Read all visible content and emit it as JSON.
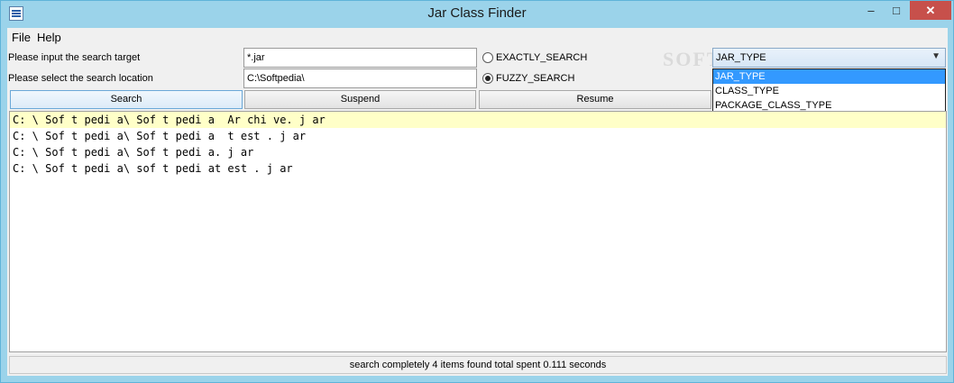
{
  "window": {
    "title": "Jar Class Finder",
    "controls": {
      "minimize": "–",
      "maximize": "□",
      "close": "✕"
    }
  },
  "menu": {
    "items": [
      "File",
      "Help"
    ]
  },
  "form": {
    "target_label": "Please input the search target",
    "target_value": "*.jar",
    "location_label": "Please select the search location",
    "location_value": "C:\\Softpedia\\",
    "radio_exact": {
      "label": "EXACTLY_SEARCH",
      "checked": false
    },
    "radio_fuzzy": {
      "label": "FUZZY_SEARCH",
      "checked": true
    },
    "combo": {
      "selected": "JAR_TYPE",
      "options": [
        "JAR_TYPE",
        "CLASS_TYPE",
        "PACKAGE_CLASS_TYPE"
      ],
      "highlighted_index": 0
    }
  },
  "buttons": {
    "search": "Search",
    "suspend": "Suspend",
    "resume": "Resume"
  },
  "results": [
    "C: \\ Sof t pedi a\\ Sof t pedi a  Ar chi ve. j ar",
    "C: \\ Sof t pedi a\\ Sof t pedi a  t est . j ar",
    "C: \\ Sof t pedi a\\ Sof t pedi a. j ar",
    "C: \\ Sof t pedi a\\ sof t pedi at est . j ar"
  ],
  "status": "search completely 4 items found total spent 0.111 seconds",
  "watermark": "SOFTPEDIA",
  "colors": {
    "highlight_row": "#ffffc8",
    "dropdown_selected": "#3399ff",
    "close_button": "#c7504b"
  }
}
